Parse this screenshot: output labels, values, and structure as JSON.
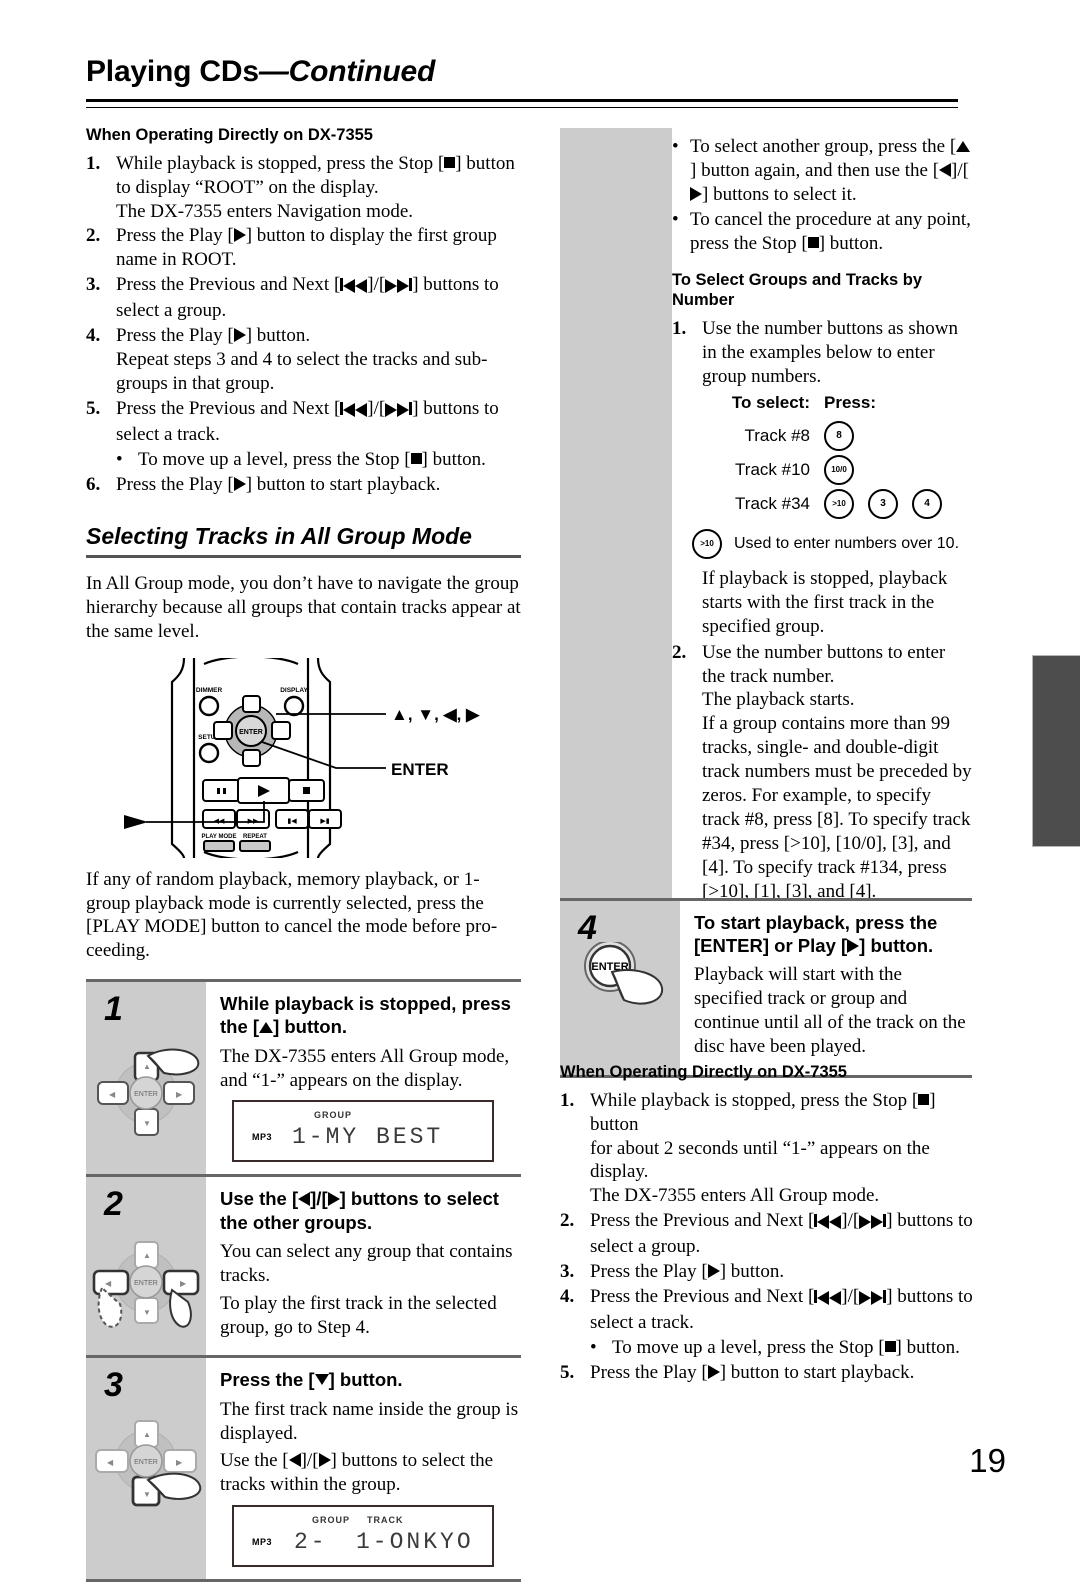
{
  "header": {
    "title_main": "Playing CDs",
    "title_cont": "—Continued"
  },
  "left_column": {
    "heading": "When Operating Directly on DX-7355",
    "steps": [
      {
        "num": "1.",
        "lines": [
          "While playback is stopped, press the Stop [■] button",
          "to display “ROOT” on the display.",
          "The DX-7355 enters Navigation mode."
        ]
      },
      {
        "num": "2.",
        "lines": [
          "Press the Play [▶] button to display the first group",
          "name in ROOT."
        ]
      },
      {
        "num": "3.",
        "lines": [
          "Press the Previous and Next [⏮]/[⏭] buttons to",
          "select a group."
        ]
      },
      {
        "num": "4.",
        "lines": [
          "Press the Play [▶] button.",
          "Repeat steps 3 and 4 to select the tracks and sub-",
          "groups in that group."
        ]
      },
      {
        "num": "5.",
        "lines": [
          "Press the Previous and Next [⏮]/[⏭] buttons to",
          "select a track."
        ],
        "bullet": "To move up a level, press the Stop [■] button."
      },
      {
        "num": "6.",
        "lines": [
          "Press the Play [▶] button to start playback."
        ]
      }
    ],
    "section_title": "Selecting Tracks in All Group Mode",
    "intro": "In All Group mode, you don’t have to navigate the group hierarchy because all groups that contain tracks appear at the same level.",
    "remote": {
      "label_dimmer": "DIMMER",
      "label_display": "DISPLAY",
      "label_setup": "SETUP",
      "label_enter": "ENTER",
      "label_playmode": "PLAY MODE",
      "label_repeat": "REPEAT",
      "callout_arrows": "▲, ▼, ◀, ▶",
      "callout_enter": "ENTER"
    },
    "note": "If any of random playback, memory playback, or 1-group playback mode is currently selected, press the [PLAY MODE] button to cancel the mode before pro-ceeding.",
    "boxes": [
      {
        "num": "1",
        "title": "While playback is stopped, press the [▲] button.",
        "paras": [
          "The DX-7355 enters All Group mode, and “1-” appears on the display."
        ],
        "display": {
          "labels": [
            "GROUP"
          ],
          "segments": "1-MY BEST",
          "mp3": "MP3"
        }
      },
      {
        "num": "2",
        "title": "Use the [◀]/[▶] buttons to select the other groups.",
        "paras": [
          "You can select any group that contains tracks.",
          "To play the first track in the selected group, go to Step 4."
        ]
      },
      {
        "num": "3",
        "title": "Press the [▼] button.",
        "paras": [
          "The first track name inside the group is displayed.",
          "Use the [◀]/[▶] buttons to select the tracks within the group."
        ],
        "display": {
          "labels": [
            "GROUP",
            "TRACK"
          ],
          "segments_group": "2-",
          "segments": "1-ONKYO",
          "mp3": "MP3"
        }
      }
    ]
  },
  "right_column": {
    "bullets": [
      "To select another group, press the [▲] button again, and then use the [◀]/[▶] buttons to select it.",
      "To cancel the procedure at any point, press the Stop [■] button."
    ],
    "heading": "To Select Groups and Tracks by Number",
    "step1": {
      "num": "1.",
      "text": "Use the number buttons as shown in the examples below to enter group numbers."
    },
    "number_table": {
      "col1_header": "To select:",
      "col2_header": "Press:",
      "rows": [
        {
          "label": "Track #8",
          "buttons": [
            "8"
          ]
        },
        {
          "label": "Track #10",
          "buttons": [
            "10/0"
          ]
        },
        {
          "label": "Track #34",
          "buttons": [
            ">10",
            "3",
            "4"
          ]
        }
      ],
      "note_button": ">10",
      "note_text": "Used to enter numbers over 10."
    },
    "after_table": "If playback is stopped, playback starts with the first track in the specified group.",
    "step2": {
      "num": "2.",
      "lines": [
        "Use the number buttons to enter the track number.",
        "The playback starts.",
        "If a group contains more than 99 tracks, single- and double-digit track numbers must be preceded by zeros. For example, to specify track #8, press [8]. To specify track #34, press [>10], [10/0], [3], and [4]. To specify track #134, press [>10], [1], [3], and [4]."
      ]
    },
    "box4": {
      "num": "4",
      "title": "To start playback, press the [ENTER] or Play [▶] button.",
      "paras": [
        "Playback will start with the specified track or group and continue until all of the track on the disc have been played."
      ],
      "enter_label": "ENTER"
    },
    "heading2": "When Operating Directly on DX-7355",
    "steps2": [
      {
        "num": "1.",
        "lines": [
          "While playback is stopped, press the Stop [■] button",
          "for about 2 seconds until “1-” appears on the display.",
          "The DX-7355 enters All Group mode."
        ]
      },
      {
        "num": "2.",
        "lines": [
          "Press the Previous and Next [⏮]/[⏭] buttons to",
          "select a group."
        ]
      },
      {
        "num": "3.",
        "lines": [
          "Press the Play [▶] button."
        ]
      },
      {
        "num": "4.",
        "lines": [
          "Press the Previous and Next [⏮]/[⏭] buttons to",
          "select a track."
        ],
        "bullet": "To move up a level, press the Stop [■] button."
      },
      {
        "num": "5.",
        "lines": [
          "Press the Play [▶] button to start playback."
        ]
      }
    ]
  },
  "page_number": "19",
  "colors": {
    "gray_panel": "#cccccc",
    "edge_tab": "#4d4d4d",
    "rule": "#666666"
  }
}
